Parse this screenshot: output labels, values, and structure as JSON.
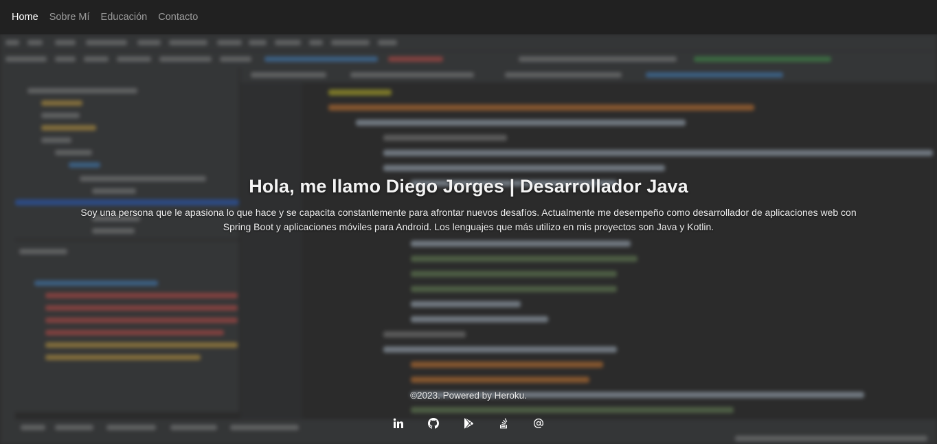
{
  "nav": {
    "items": [
      {
        "label": "Home",
        "active": true
      },
      {
        "label": "Sobre Mí",
        "active": false
      },
      {
        "label": "Educación",
        "active": false
      },
      {
        "label": "Contacto",
        "active": false
      }
    ]
  },
  "hero": {
    "title": "Hola, me llamo Diego Jorges | Desarrollador Java",
    "description": "Soy una persona que le apasiona lo que hace y se capacita constantemente para afrontar nuevos desafíos. Actualmente me desempeño como desarrollador de aplicaciones web con Spring Boot y aplicaciones móviles para Android. Los lenguajes que más utilizo en mis proyectos son Java y Kotlin."
  },
  "footer": {
    "copyright": "©2023. Powered by Heroku."
  },
  "social": [
    {
      "icon": "linkedin-icon"
    },
    {
      "icon": "github-icon"
    },
    {
      "icon": "google-play-icon"
    },
    {
      "icon": "stack-overflow-icon"
    },
    {
      "icon": "email-at-icon"
    }
  ],
  "colors": {
    "navbar_bg": "#212121",
    "nav_active": "#ffffff",
    "nav_inactive": "#8c8c8c",
    "text": "#f0f0f0"
  }
}
